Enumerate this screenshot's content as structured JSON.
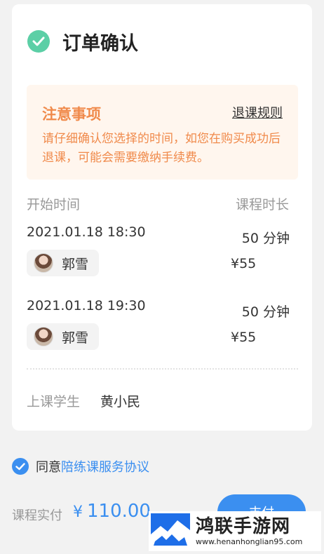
{
  "header": {
    "title": "订单确认"
  },
  "notice": {
    "title": "注意事项",
    "link": "退课规则",
    "body": "请仔细确认您选择的时间，如您在购买成功后退课，可能会需要缴纳手续费。"
  },
  "columns": {
    "start": "开始时间",
    "duration": "课程时长"
  },
  "sessions": [
    {
      "time": "2021.01.18   18:30",
      "tutor": "郭雪",
      "duration": "50 分钟",
      "price": "¥55"
    },
    {
      "time": "2021.01.18   19:30",
      "tutor": "郭雪",
      "duration": "50 分钟",
      "price": "¥55"
    }
  ],
  "student": {
    "label": "上课学生",
    "name": "黄小民"
  },
  "agreement": {
    "prefix": "同意",
    "link": "陪练课服务协议"
  },
  "payment": {
    "label": "课程实付",
    "currency": "¥",
    "amount": "110.00",
    "button": "支付"
  },
  "watermark": {
    "title": "鸿联手游网",
    "url": "www.henanhonglian95.com"
  },
  "colors": {
    "accent": "#3b8ff0",
    "success": "#5ccfa6",
    "notice": "#f08a4b"
  }
}
